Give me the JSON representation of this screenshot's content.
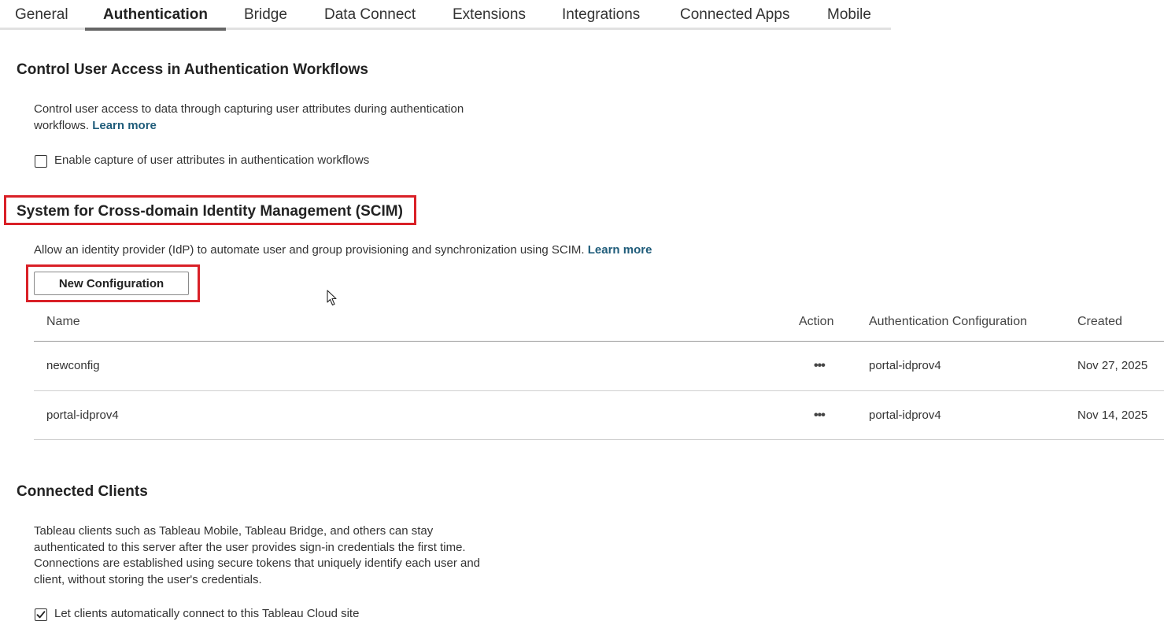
{
  "tabs": [
    {
      "label": "General"
    },
    {
      "label": "Authentication",
      "active": true
    },
    {
      "label": "Bridge"
    },
    {
      "label": "Data Connect"
    },
    {
      "label": "Extensions"
    },
    {
      "label": "Integrations"
    },
    {
      "label": "Connected Apps"
    },
    {
      "label": "Mobile"
    }
  ],
  "user_access": {
    "title": "Control User Access in Authentication Workflows",
    "description": "Control user access to data through capturing user attributes during authentication workflows.",
    "learn_more": "Learn more",
    "checkbox_label": "Enable capture of user attributes in authentication workflows",
    "checkbox_checked": false
  },
  "scim": {
    "title": "System for Cross-domain Identity Management (SCIM)",
    "description": "Allow an identity provider (IdP) to automate user and group provisioning and synchronization using SCIM.",
    "learn_more": "Learn more",
    "new_button": "New Configuration",
    "columns": {
      "name": "Name",
      "action": "Action",
      "auth_config": "Authentication Configuration",
      "created": "Created"
    },
    "rows": [
      {
        "name": "newconfig",
        "action": "•••",
        "auth_config": "portal-idprov4",
        "created": "Nov 27, 2025"
      },
      {
        "name": "portal-idprov4",
        "action": "•••",
        "auth_config": "portal-idprov4",
        "created": "Nov 14, 2025"
      }
    ]
  },
  "connected_clients": {
    "title": "Connected Clients",
    "description": "Tableau clients such as Tableau Mobile, Tableau Bridge, and others can stay authenticated to this server after the user provides sign-in credentials the first time. Connections are established using secure tokens that uniquely identify each user and client, without storing the user's credentials.",
    "checkbox_label": "Let clients automatically connect to this Tableau Cloud site",
    "checkbox_checked": true
  },
  "colors": {
    "highlight": "#d92027",
    "link": "#1f5c7a",
    "active_tab_underline": "#666666"
  }
}
